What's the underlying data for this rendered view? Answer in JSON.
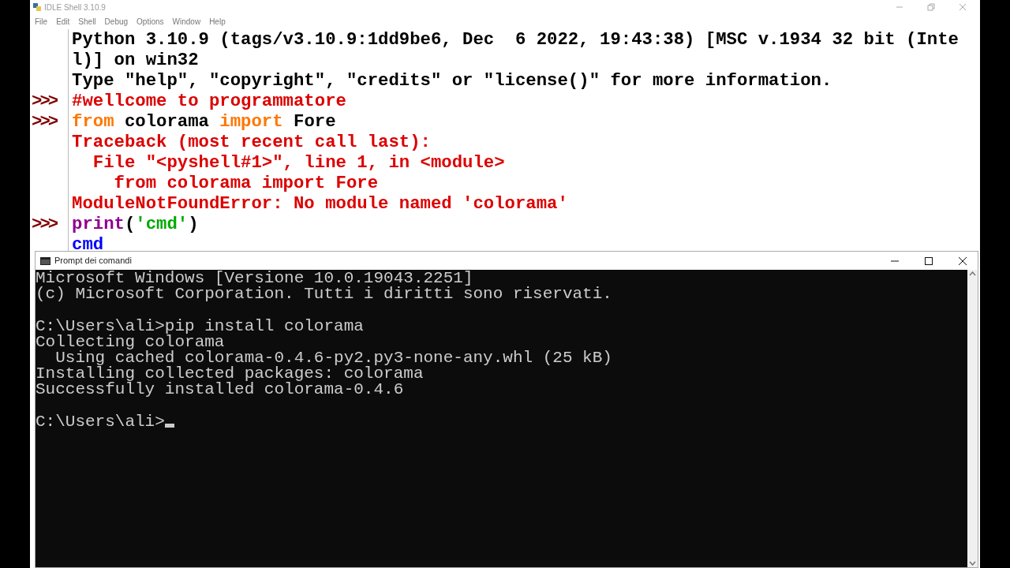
{
  "idle_window": {
    "title": "IDLE Shell 3.10.9",
    "menu": [
      "File",
      "Edit",
      "Shell",
      "Debug",
      "Options",
      "Window",
      "Help"
    ],
    "lines": [
      {
        "segments": [
          {
            "text": "Python 3.10.9 (tags/v3.10.9:1dd9be6, Dec  6 2022, 19:43:38) [MSC v.1934 32 bit (Inte",
            "kind": "output"
          }
        ]
      },
      {
        "segments": [
          {
            "text": "l)] on win32",
            "kind": "output"
          }
        ]
      },
      {
        "segments": [
          {
            "text": "Type \"help\", \"copyright\", \"credits\" or \"license()\" for more information.",
            "kind": "output"
          }
        ]
      },
      {
        "prompt": ">>>",
        "segments": [
          {
            "text": "#wellcome to programmatore",
            "kind": "comment"
          }
        ]
      },
      {
        "prompt": ">>>",
        "segments": [
          {
            "text": "from",
            "kind": "keyword"
          },
          {
            "text": " colorama ",
            "kind": "code"
          },
          {
            "text": "import",
            "kind": "keyword"
          },
          {
            "text": " Fore",
            "kind": "code"
          }
        ]
      },
      {
        "segments": [
          {
            "text": "Traceback (most recent call last):",
            "kind": "error"
          }
        ]
      },
      {
        "segments": [
          {
            "text": "  File \"<pyshell#1>\", line 1, in <module>",
            "kind": "error"
          }
        ]
      },
      {
        "segments": [
          {
            "text": "    from colorama import Fore",
            "kind": "error"
          }
        ]
      },
      {
        "segments": [
          {
            "text": "ModuleNotFoundError: No module named 'colorama'",
            "kind": "error"
          }
        ]
      },
      {
        "prompt": ">>>",
        "segments": [
          {
            "text": "print",
            "kind": "builtin"
          },
          {
            "text": "(",
            "kind": "code"
          },
          {
            "text": "'cmd'",
            "kind": "string"
          },
          {
            "text": ")",
            "kind": "code"
          }
        ]
      },
      {
        "segments": [
          {
            "text": "cmd",
            "kind": "stdout"
          }
        ]
      }
    ]
  },
  "cmd_window": {
    "title": "Prompt dei comandi",
    "blocks": [
      [
        "Microsoft Windows [Versione 10.0.19043.2251]",
        "(c) Microsoft Corporation. Tutti i diritti sono riservati."
      ],
      [
        "C:\\Users\\ali>pip install colorama",
        "Collecting colorama",
        "  Using cached colorama-0.4.6-py2.py3-none-any.whl (25 kB)",
        "Installing collected packages: colorama",
        "Successfully installed colorama-0.4.6"
      ],
      [
        "C:\\Users\\ali>"
      ]
    ]
  }
}
